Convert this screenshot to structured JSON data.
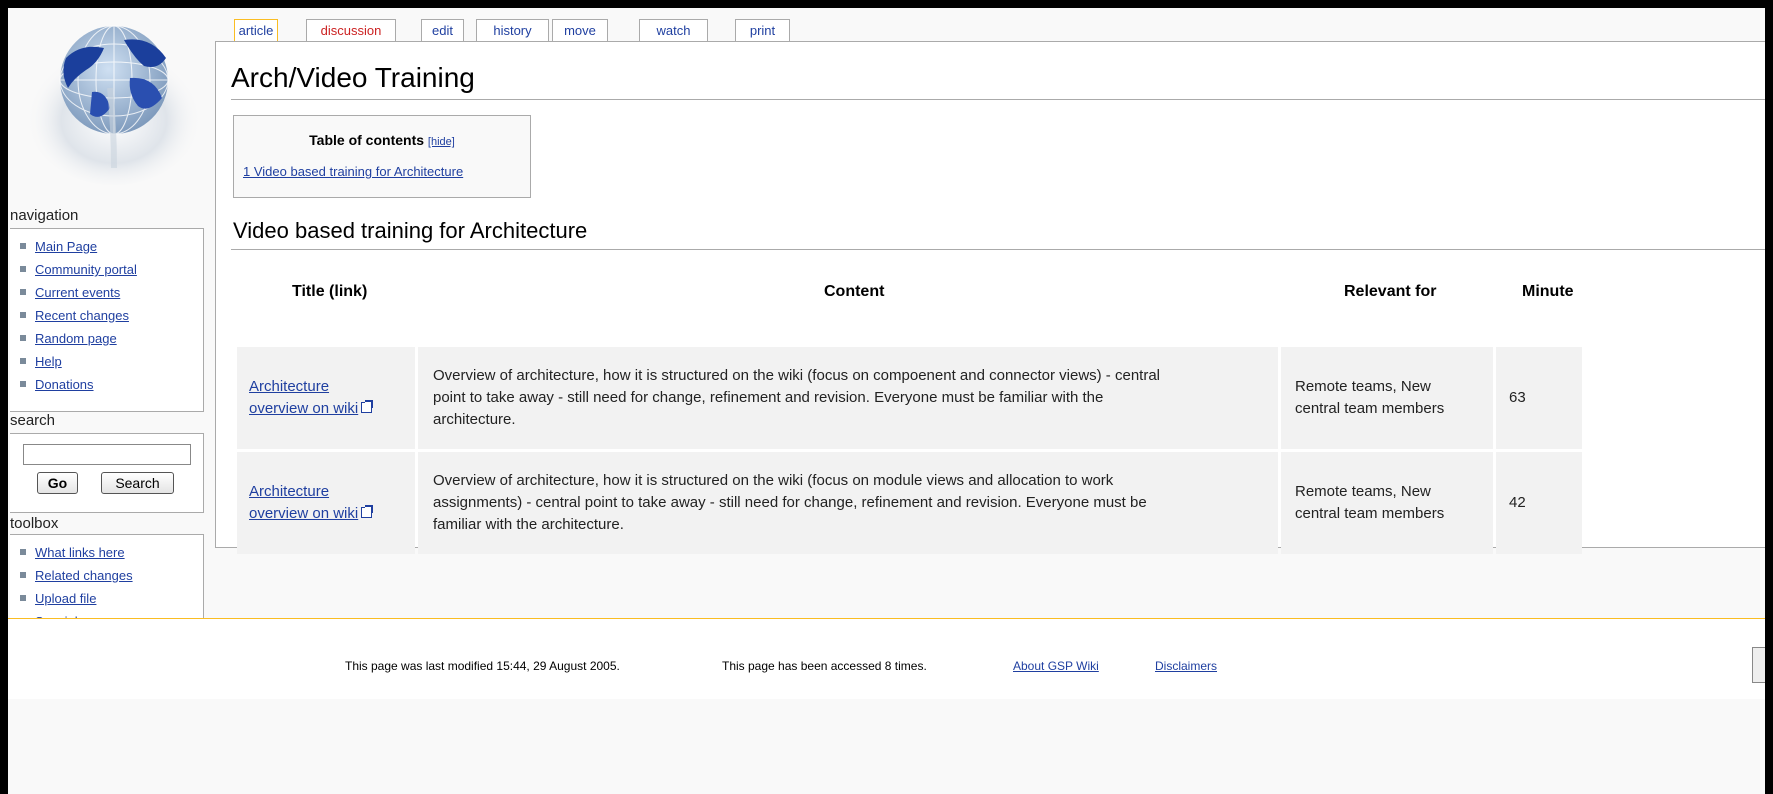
{
  "tabs": [
    {
      "label": "article",
      "active": true
    },
    {
      "label": "discussion"
    },
    {
      "label": "edit"
    },
    {
      "label": "history"
    },
    {
      "label": "move"
    },
    {
      "label": "watch"
    },
    {
      "label": "print"
    }
  ],
  "sidebar": {
    "navigation": {
      "title": "navigation",
      "items": [
        "Main Page",
        "Community portal",
        "Current events",
        "Recent changes",
        "Random page",
        "Help",
        "Donations"
      ]
    },
    "search": {
      "title": "search",
      "input_value": "",
      "go_label": "Go",
      "search_label": "Search"
    },
    "toolbox": {
      "title": "toolbox",
      "items": [
        "What links here",
        "Related changes",
        "Upload file",
        "Special pages"
      ]
    }
  },
  "page": {
    "title": "Arch/Video Training",
    "toc": {
      "heading": "Table of contents",
      "hide_label": "[hide]",
      "entries": [
        "1 Video based training for Architecture"
      ]
    },
    "section_heading": "Video based training for Architecture"
  },
  "table": {
    "headers": [
      "Title (link)",
      "Content",
      "Relevant for",
      "Minute"
    ],
    "rows": [
      {
        "title_line1": "Architecture",
        "title_line2": "overview on wiki",
        "content_lines": [
          "Overview of architecture, how it is structured on the wiki (focus on compoenent and connector views) - central",
          "point to take away - still need for change, refinement and revision. Everyone must be familiar with the",
          "architecture."
        ],
        "relevant_lines": [
          "Remote teams, New",
          "central team members"
        ],
        "minutes": "63"
      },
      {
        "title_line1": "Architecture",
        "title_line2": "overview on wiki",
        "content_lines": [
          "Overview of architecture, how it is structured on the wiki (focus on module views and allocation to work",
          "assignments) - central point to take away - still need for change, refinement and revision. Everyone must be",
          "familiar with the architecture."
        ],
        "relevant_lines": [
          "Remote teams, New",
          "central team members"
        ],
        "minutes": "42"
      }
    ]
  },
  "footer": {
    "last_modified": "This page was last modified 15:44, 29 August 2005.",
    "accessed": "This page has been accessed 8 times.",
    "about_link": "About GSP Wiki",
    "disclaimers_link": "Disclaimers"
  },
  "colors": {
    "link": "#1f3fa0",
    "new_link": "#cc2222",
    "active_tab_border": "#fabd23",
    "table_cell_bg": "#f2f2f2"
  },
  "icons": {
    "logo": "globe-logo",
    "external_link": "external-link-icon",
    "bullet": "square-bullet-icon"
  }
}
